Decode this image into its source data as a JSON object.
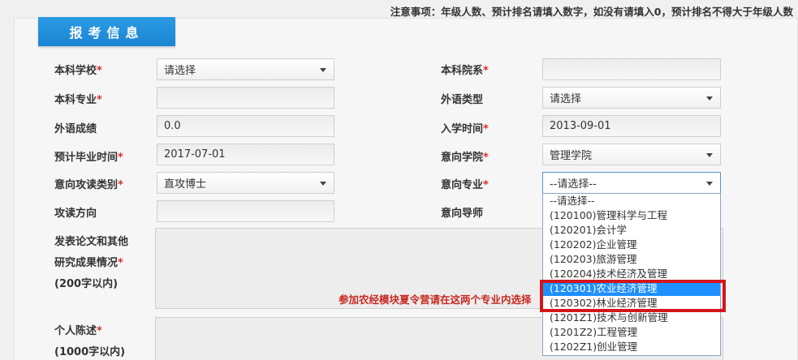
{
  "notice": "注意事项：年级人数、预计排名请填入数字，如没有请填入0，预计排名不得大于年级人数",
  "section_title": "报考信息",
  "fields": {
    "school": {
      "label": "本科学校",
      "value": "请选择"
    },
    "department": {
      "label": "本科院系",
      "value": ""
    },
    "major": {
      "label": "本科专业",
      "value": ""
    },
    "lang_type": {
      "label": "外语类型",
      "value": "请选择"
    },
    "lang_score": {
      "label": "外语成绩",
      "value": "0.0"
    },
    "enroll_time": {
      "label": "入学时间",
      "value": "2013-09-01"
    },
    "grad_time": {
      "label": "预计毕业时间",
      "value": "2017-07-01"
    },
    "target_college": {
      "label": "意向学院",
      "value": "管理学院"
    },
    "study_type": {
      "label": "意向攻读类别",
      "value": "直攻博士"
    },
    "target_major": {
      "label": "意向专业",
      "value": "--请选择--"
    },
    "direction": {
      "label": "攻读方向",
      "value": ""
    },
    "tutor": {
      "label": "意向导师",
      "value": ""
    },
    "papers": {
      "label_line1": "发表论文和其他",
      "label_line2": "研究成果情况",
      "label_line3": "(200字以内)"
    },
    "statement": {
      "label_line1": "个人陈述",
      "label_line2": "(1000字以内)"
    }
  },
  "required_mark": "*",
  "hint": "参加农经模块夏令营请在这两个专业内选择",
  "dropdown_options": [
    "--请选择--",
    "(120100)管理科学与工程",
    "(120201)会计学",
    "(120202)企业管理",
    "(120203)旅游管理",
    "(120204)技术经济及管理",
    "(120301)农业经济管理",
    "(120302)林业经济管理",
    "(1201Z1)技术与创新管理",
    "(1201Z2)工程管理",
    "(1202Z1)创业管理"
  ],
  "selected_option_index": 6,
  "colors": {
    "accent": "#1e90ff",
    "tab": "#2b9ae4",
    "required": "#d3302c",
    "highlight": "#d4161c"
  }
}
